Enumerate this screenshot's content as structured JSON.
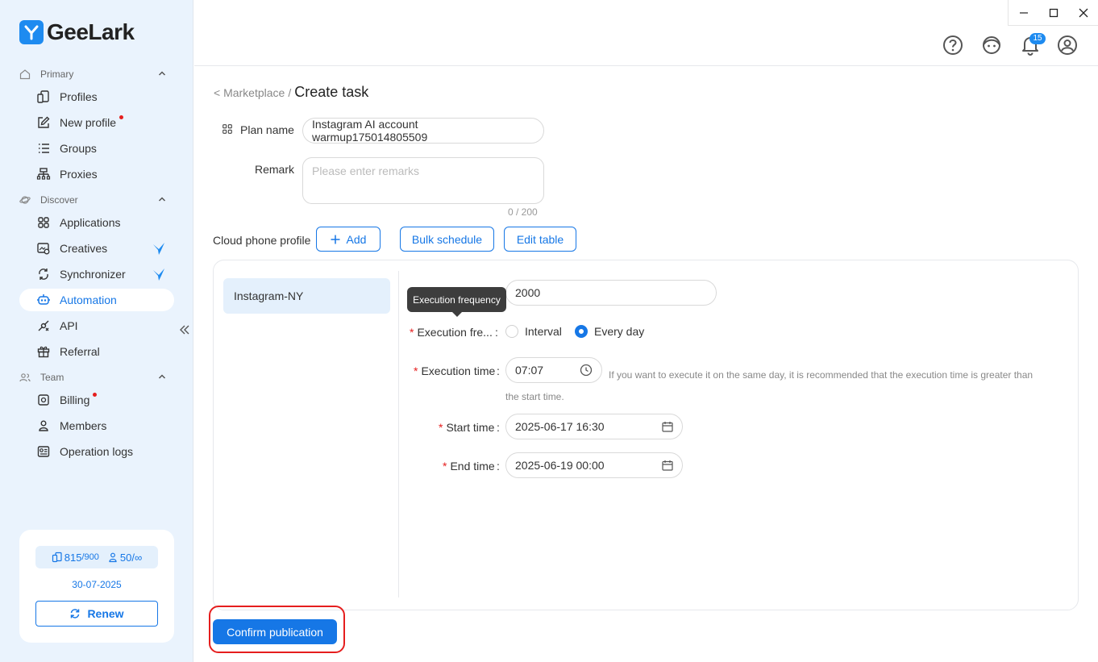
{
  "app": {
    "name": "GeeLark"
  },
  "sidebar": {
    "sections": {
      "primary": "Primary",
      "discover": "Discover",
      "team": "Team"
    },
    "items": {
      "profiles": "Profiles",
      "new_profile": "New profile",
      "groups": "Groups",
      "proxies": "Proxies",
      "applications": "Applications",
      "creatives": "Creatives",
      "synchronizer": "Synchronizer",
      "automation": "Automation",
      "api": "API",
      "referral": "Referral",
      "billing": "Billing",
      "members": "Members",
      "operation_logs": "Operation logs"
    },
    "active_item": "Automation",
    "plan": {
      "profiles_used": "815",
      "profiles_total": "/900",
      "members_used": "50/",
      "members_total": "∞",
      "expiry_date": "30-07-2025",
      "renew_label": "Renew"
    }
  },
  "header": {
    "notification_count": "15"
  },
  "breadcrumb": {
    "back_link": "< Marketplace",
    "separator": "/",
    "current": "Create task"
  },
  "form": {
    "plan_name_label": "Plan name",
    "plan_name_value": "Instagram AI account warmup175014805509",
    "remark_label": "Remark",
    "remark_placeholder": "Please enter remarks",
    "remark_counter": "0 / 200",
    "cloud_phone_label": "Cloud phone profile",
    "add_button": "Add",
    "bulk_schedule_button": "Bulk schedule",
    "edit_table_button": "Edit table"
  },
  "panel": {
    "profile_name": "Instagram-NY",
    "count_value": "2000",
    "tooltip_text": "Execution frequency",
    "execution_frequency_label": "Execution fre...",
    "frequency_options": [
      "Interval",
      "Every day"
    ],
    "frequency_selected": "Every day",
    "execution_time_label": "Execution time",
    "execution_time_value": "07:07",
    "execution_time_hint": "If you want to execute it on the same day, it is recommended that the execution time is greater than the start time.",
    "start_time_label": "Start time",
    "start_time_value": "2025-06-17 16:30",
    "end_time_label": "End time",
    "end_time_value": "2025-06-19 00:00",
    "colon": ":"
  },
  "footer": {
    "confirm_button": "Confirm publication"
  },
  "colors": {
    "accent": "#1677e6",
    "sidebar_bg": "#eaf3fd",
    "required": "#e51e1e",
    "highlight_ring": "#e51e1e"
  }
}
